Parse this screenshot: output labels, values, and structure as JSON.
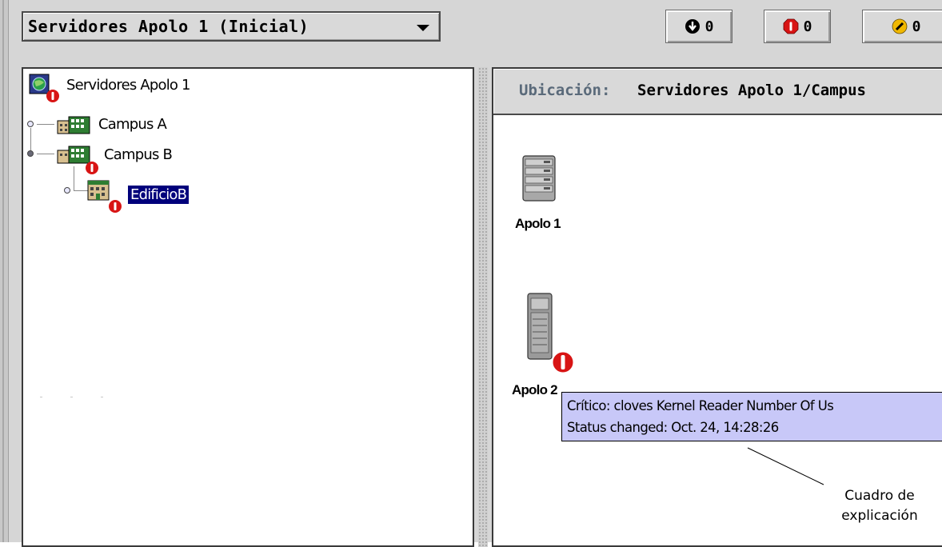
{
  "toolbar": {
    "view_selector": {
      "value": "Servidores Apolo 1 (Inicial)"
    },
    "alarm_counts": [
      {
        "icon": "down-alarm-icon",
        "count": "0",
        "color": "#000000"
      },
      {
        "icon": "critical-alarm-icon",
        "count": "0",
        "color": "#d81414"
      },
      {
        "icon": "major-alarm-icon",
        "count": "0",
        "color": "#f0b800"
      }
    ]
  },
  "tree": {
    "root": {
      "label": "Servidores Apolo 1",
      "icon": "domain-globe-icon"
    },
    "items": [
      {
        "label": "Campus A",
        "icon": "building-group-icon",
        "expanded": false
      },
      {
        "label": "Campus B",
        "icon": "building-group-icon",
        "expanded": true
      },
      {
        "label": "EdificioB",
        "icon": "building-icon",
        "selected": true
      }
    ]
  },
  "location": {
    "label": "Ubicación:",
    "path": "Servidores Apolo 1/Campus"
  },
  "hosts": [
    {
      "label": "Apolo 1",
      "icon": "rack-server-icon"
    },
    {
      "label": "Apolo 2",
      "icon": "tower-server-icon",
      "alarm": "critical"
    }
  ],
  "tooltip": {
    "line1": "Crítico: cloves  Kernel Reader  Number Of Us",
    "line2": "Status changed: Oct. 24, 14:28:26"
  },
  "callout": {
    "line1": "Cuadro de",
    "line2": "explicación"
  },
  "colors": {
    "selection": "#00007b",
    "tooltip_bg": "#c8c8f8",
    "critical": "#d81414"
  }
}
